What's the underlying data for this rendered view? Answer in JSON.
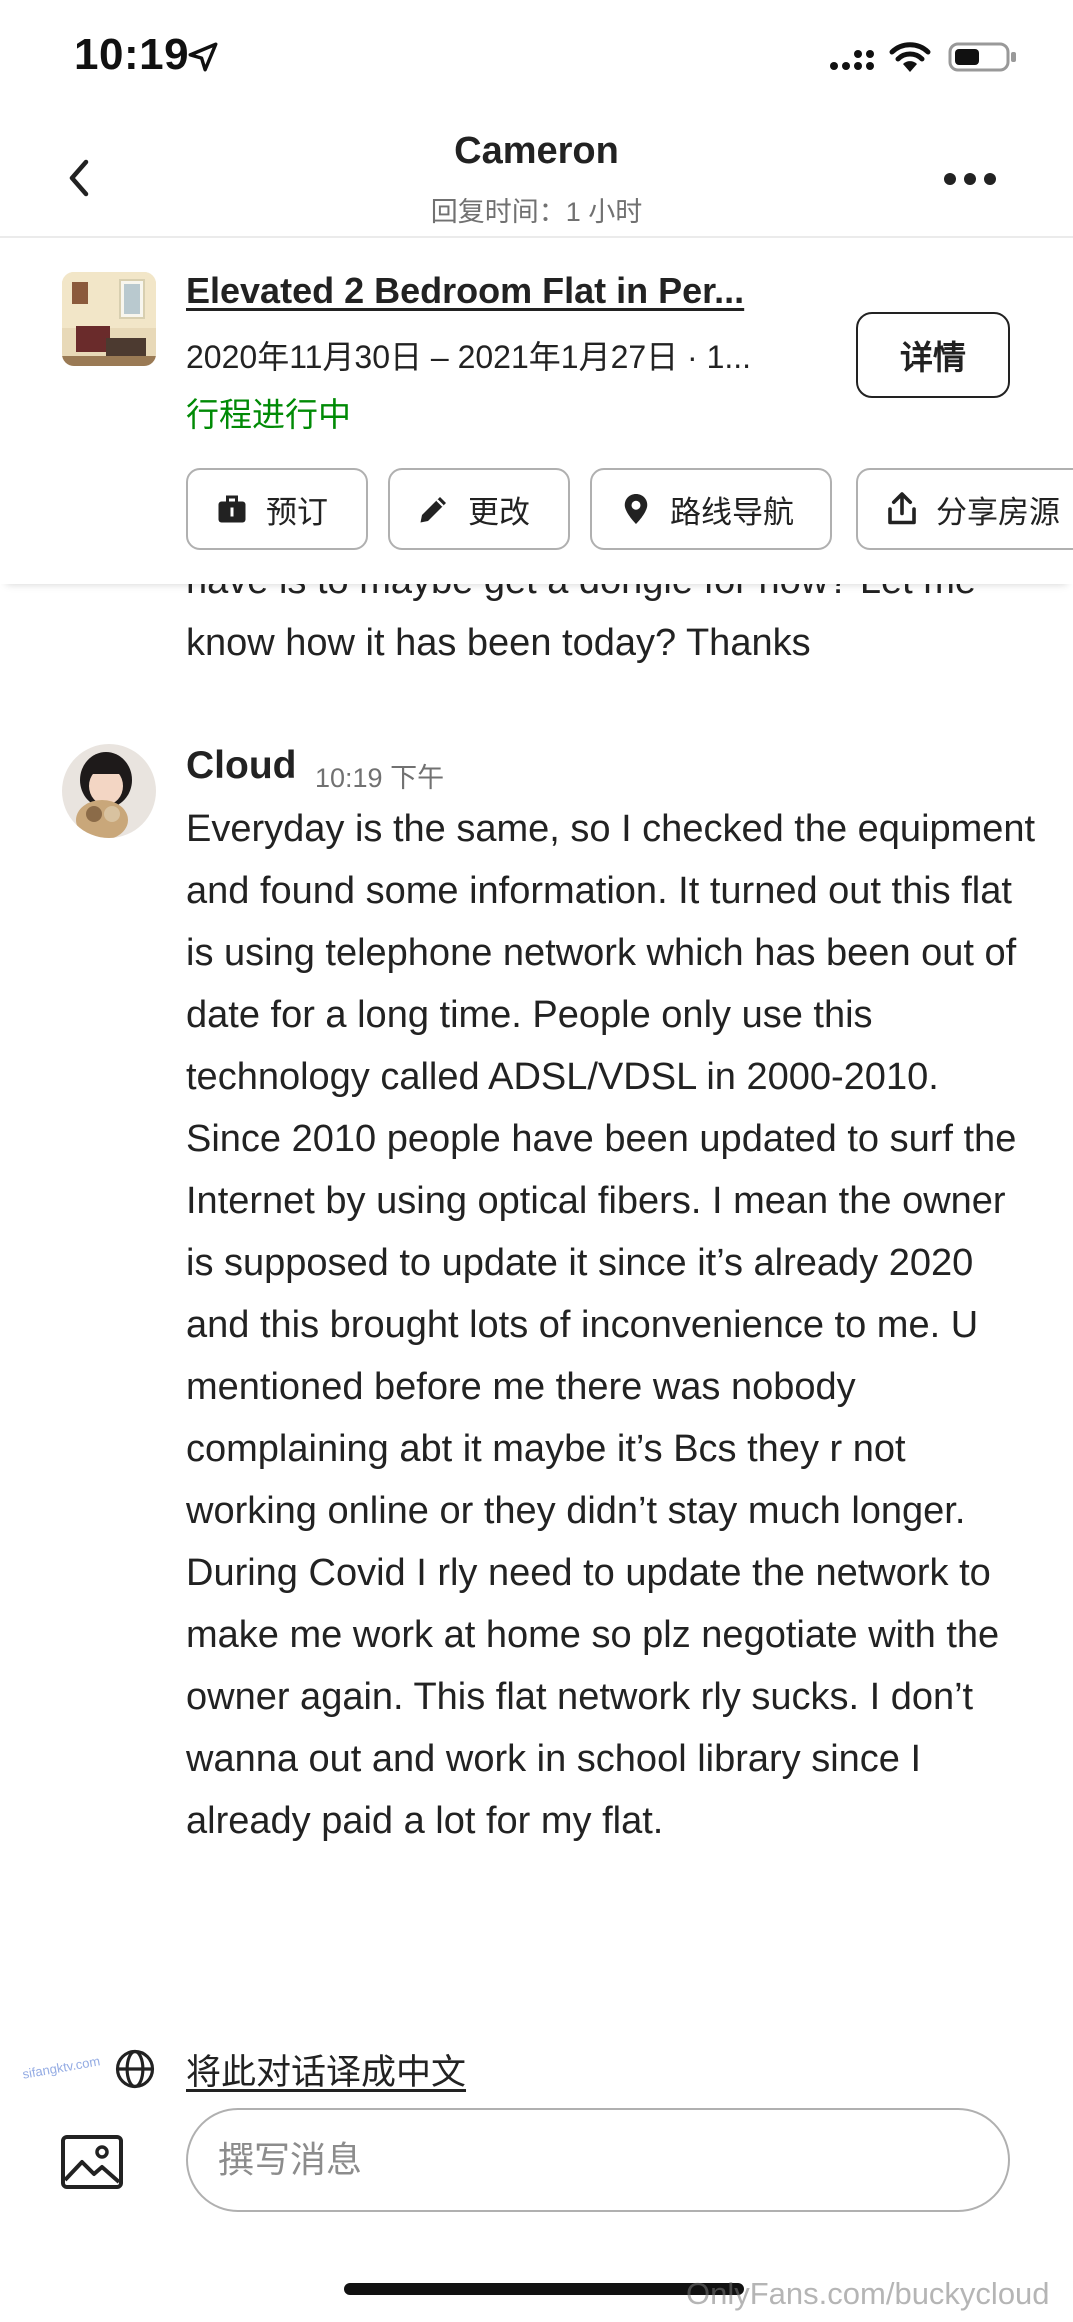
{
  "status_bar": {
    "time": "10:19",
    "icons": [
      "location-arrow-icon",
      "cellular-signal-icon",
      "wifi-icon",
      "battery-icon"
    ]
  },
  "header": {
    "title": "Cameron",
    "subtitle": "回复时间：1 小时",
    "icons": [
      "chevron-left-icon",
      "more-dots-icon"
    ]
  },
  "listing": {
    "title": "Elevated 2 Bedroom Flat in Per...",
    "dates": "2020年11月30日 – 2021年1月27日 · 1...",
    "status": "行程进行中",
    "status_color": "#008a05",
    "details_label": "详情",
    "actions": [
      {
        "label": "预订",
        "icon": "suitcase-icon"
      },
      {
        "label": "更改",
        "icon": "pencil-icon"
      },
      {
        "label": "路线导航",
        "icon": "map-pin-icon"
      },
      {
        "label": "分享房源",
        "icon": "share-icon"
      }
    ]
  },
  "messages": {
    "previous_tail": "have is to maybe get a dongle for now? Let me know how it has been today? Thanks",
    "latest": {
      "sender": "Cloud",
      "time": "10:19 下午",
      "body": "Everyday is the same, so I checked the equipment and found some information. It turned out this flat is using telephone network which has been out of date for a long time. People only use this technology called ADSL/VDSL in 2000-2010. Since 2010 people have been updated to surf the Internet by using optical fibers.  I mean the owner is supposed to update it since it’s already 2020 and this brought lots of inconvenience to me. U mentioned before me there was nobody complaining abt it maybe it’s Bcs they r not working online or they didn’t stay much longer. During Covid I rly need to update the network to make me work at home so plz negotiate with the owner again. This flat network rly sucks. I don’t wanna out and work in school library since I already paid a lot for my flat."
    }
  },
  "translate": {
    "label": "将此对话译成中文",
    "icon": "globe-icon"
  },
  "composer": {
    "placeholder": "撰写消息",
    "value": "",
    "icon": "image-icon"
  },
  "watermarks": {
    "bottom": "OnlyFans.com/buckycloud",
    "side": "sifangktv.com"
  }
}
